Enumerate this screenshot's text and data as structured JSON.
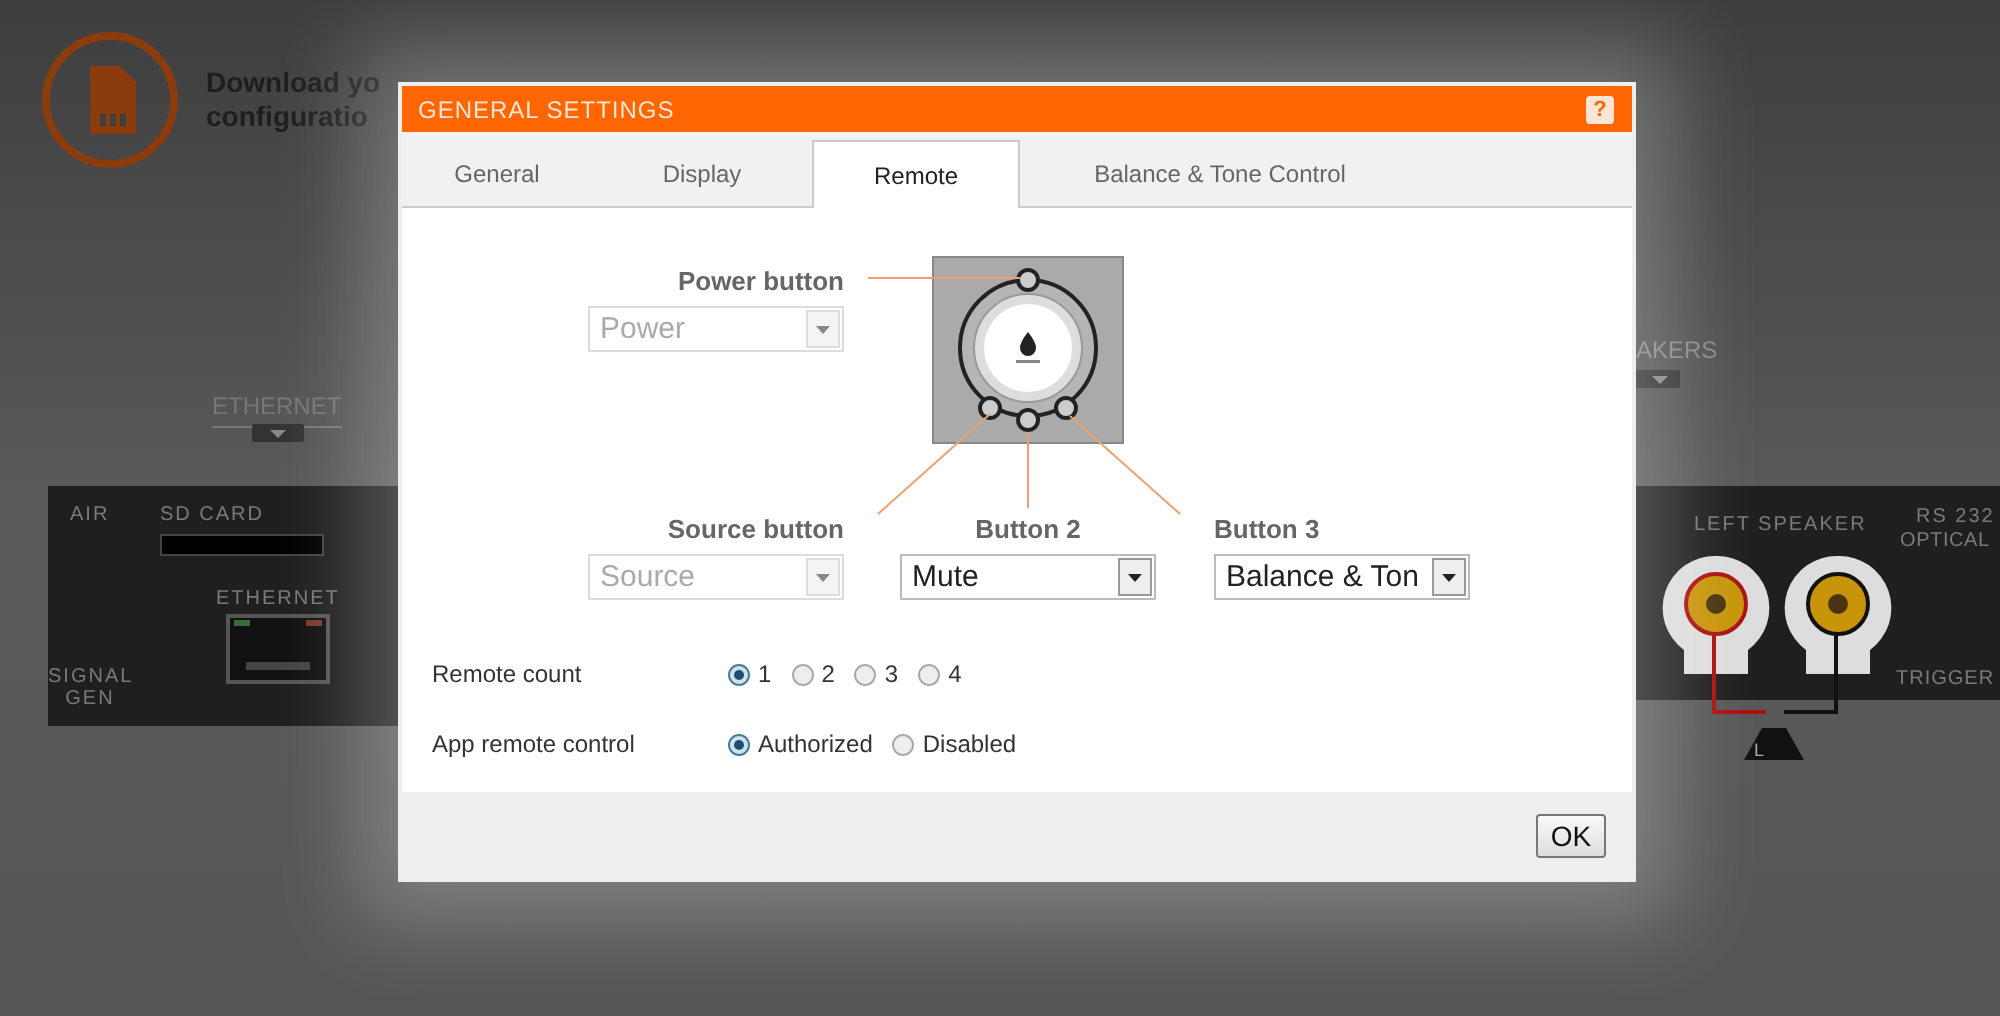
{
  "background": {
    "heading_lines": [
      "Download yo",
      "configuratio"
    ],
    "ethernet_tab": "ETHERNET",
    "speakers_tab": "AKERS",
    "left_panel": {
      "air": "AIR",
      "signal_gen": "SIGNAL GEN",
      "sd_card": "SD CARD",
      "ethernet": "ETHERNET"
    },
    "right_panel": {
      "left_speaker": "LEFT SPEAKER",
      "rs232": "RS 232",
      "optical": "OPTICAL",
      "trigger": "TRIGGER",
      "speaker_mark": "L"
    }
  },
  "dialog": {
    "title": "GENERAL SETTINGS",
    "help": "?",
    "tabs": [
      {
        "label": "General",
        "selected": false
      },
      {
        "label": "Display",
        "selected": false
      },
      {
        "label": "Remote",
        "selected": true
      },
      {
        "label": "Balance & Tone Control",
        "selected": false
      }
    ],
    "remote_buttons": [
      {
        "label": "Power button",
        "value": "Power",
        "disabled": true
      },
      {
        "label": "Source button",
        "value": "Source",
        "disabled": true
      },
      {
        "label": "Button 2",
        "value": "Mute",
        "disabled": false
      },
      {
        "label": "Button 3",
        "value": "Balance & Ton",
        "disabled": false
      }
    ],
    "settings": [
      {
        "label": "Remote count",
        "options": [
          {
            "label": "1",
            "selected": true
          },
          {
            "label": "2",
            "selected": false
          },
          {
            "label": "3",
            "selected": false
          },
          {
            "label": "4",
            "selected": false
          }
        ]
      },
      {
        "label": "App remote control",
        "options": [
          {
            "label": "Authorized",
            "selected": true
          },
          {
            "label": "Disabled",
            "selected": false
          }
        ]
      }
    ],
    "ok": "OK"
  }
}
